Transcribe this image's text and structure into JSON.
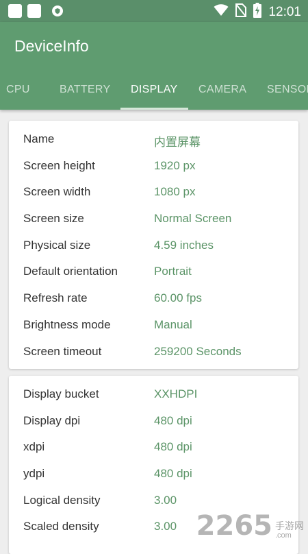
{
  "status_bar": {
    "time": "12:01",
    "icons": [
      "notification-square-icon",
      "notification-square-icon",
      "shield-icon",
      "wifi-icon",
      "no-sim-icon",
      "battery-charging-icon"
    ]
  },
  "app": {
    "title": "DeviceInfo",
    "accent_color": "#5f9c70",
    "value_color": "#5b9467"
  },
  "tabs": [
    {
      "label": "CPU"
    },
    {
      "label": "BATTERY"
    },
    {
      "label": "DISPLAY",
      "selected": true
    },
    {
      "label": "CAMERA"
    },
    {
      "label": "SENSORS"
    }
  ],
  "display_card": [
    {
      "label": "Name",
      "value": "内置屏幕"
    },
    {
      "label": "Screen height",
      "value": "1920 px"
    },
    {
      "label": "Screen width",
      "value": "1080 px"
    },
    {
      "label": "Screen size",
      "value": "Normal Screen"
    },
    {
      "label": "Physical size",
      "value": "4.59 inches"
    },
    {
      "label": "Default orientation",
      "value": "Portrait"
    },
    {
      "label": "Refresh rate",
      "value": "60.00 fps"
    },
    {
      "label": "Brightness mode",
      "value": "Manual"
    },
    {
      "label": "Screen timeout",
      "value": "259200 Seconds"
    }
  ],
  "density_card": [
    {
      "label": "Display bucket",
      "value": "XXHDPI"
    },
    {
      "label": "Display dpi",
      "value": "480 dpi"
    },
    {
      "label": "xdpi",
      "value": "480 dpi"
    },
    {
      "label": "ydpi",
      "value": "480 dpi"
    },
    {
      "label": "Logical density",
      "value": "3.00"
    },
    {
      "label": "Scaled density",
      "value": "3.00"
    }
  ],
  "watermark": {
    "number": "2265",
    "text_cn": "手游网",
    "text_url": ".com"
  }
}
